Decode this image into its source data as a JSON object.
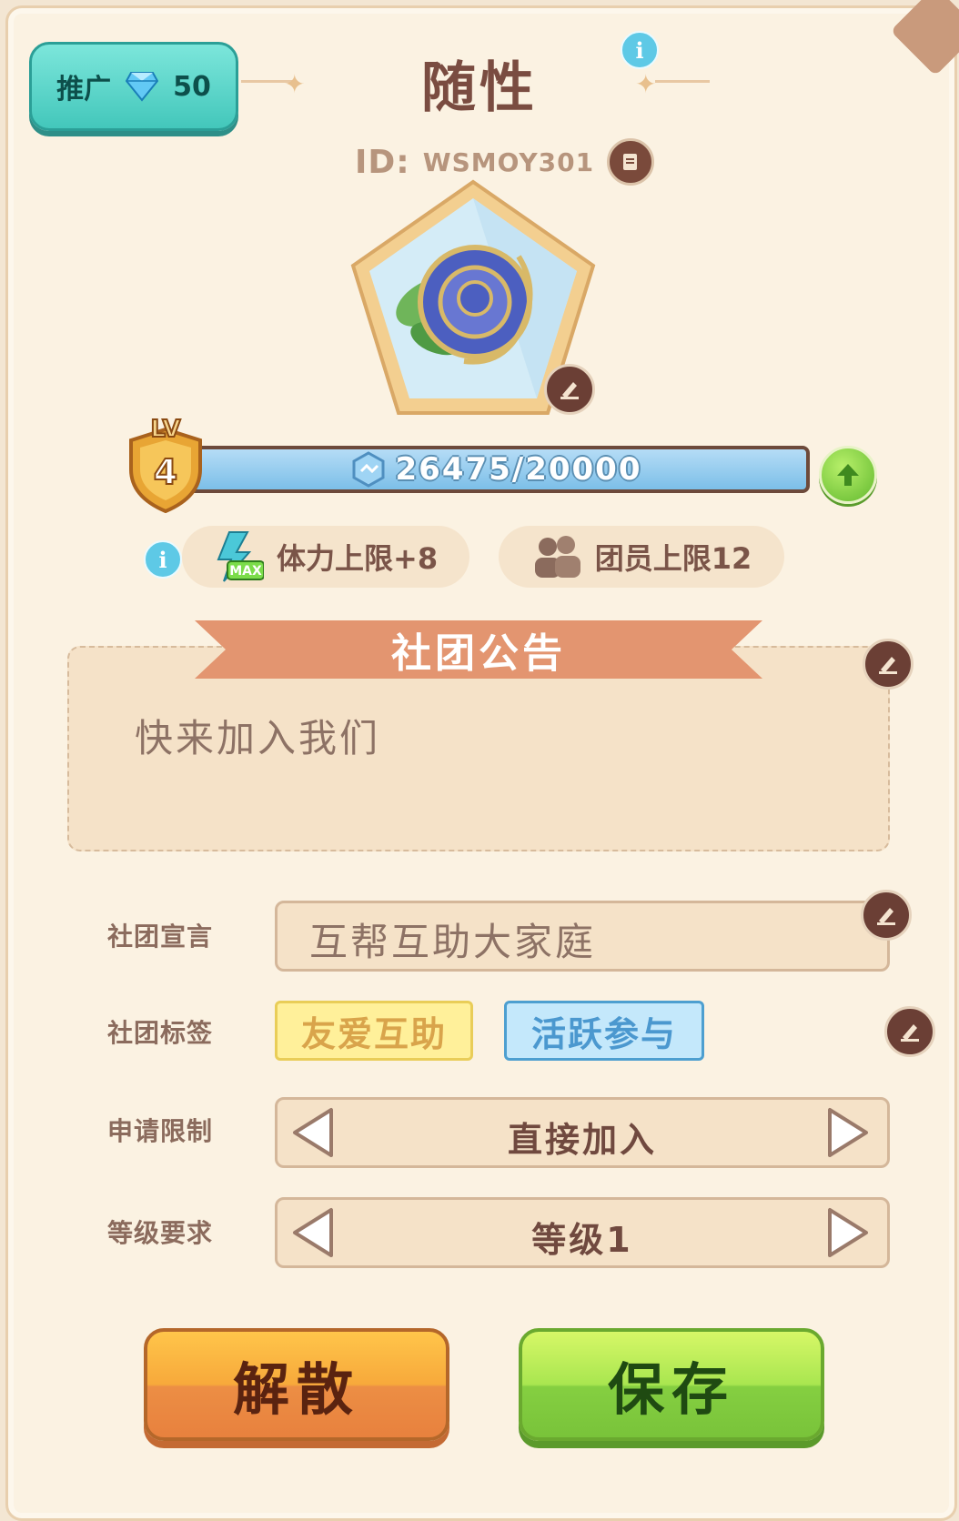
{
  "header": {
    "promo_label": "推广",
    "gem_count": "50",
    "club_name": "随性",
    "id_label": "ID:",
    "id_value": "WSMOY301"
  },
  "level": {
    "lv_label": "LV",
    "level": "4",
    "xp_text": "26475/20000",
    "progress_fraction": 1.0
  },
  "perks": {
    "stamina_label": "体力上限+8",
    "max_badge": "MAX",
    "members_label": "团员上限12"
  },
  "announcement": {
    "title": "社团公告",
    "text": "快来加入我们"
  },
  "form": {
    "declaration_label": "社团宣言",
    "declaration_value": "互帮互助大家庭",
    "tags_label": "社团标签",
    "tags": [
      "友爱互助",
      "活跃参与"
    ],
    "apply_label": "申请限制",
    "apply_value": "直接加入",
    "level_label": "等级要求",
    "level_value": "等级1"
  },
  "actions": {
    "dissolve": "解散",
    "save": "保存"
  },
  "colors": {
    "panel_bg": "#fbf2e2",
    "accent_teal": "#43c7bb",
    "ribbon": "#e39570",
    "dissolve_orange": "#f7a93b",
    "save_green": "#a9e650"
  },
  "icons": [
    "diamond-icon",
    "info-icon",
    "copy-icon",
    "rose-emblem-icon",
    "edit-icon",
    "level-shield-icon",
    "exp-icon",
    "up-arrow-icon",
    "stamina-icon",
    "members-icon",
    "left-arrow-icon",
    "right-arrow-icon"
  ]
}
